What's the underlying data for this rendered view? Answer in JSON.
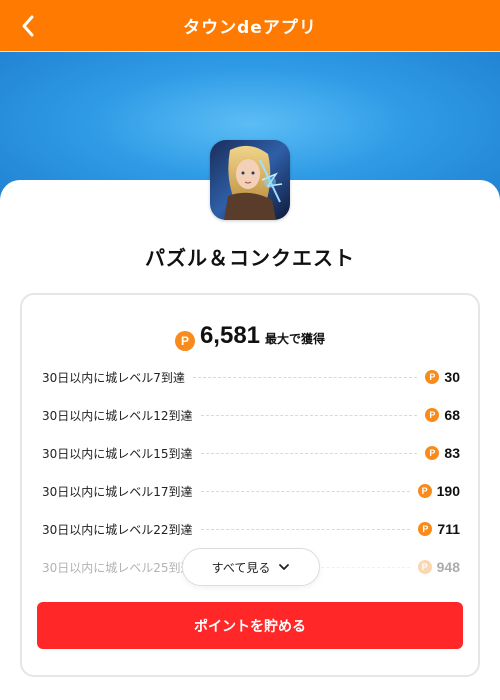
{
  "header": {
    "title": "タウンdeアプリ",
    "back_icon": "chevron-left-icon",
    "background_color": "#ff7a00"
  },
  "app": {
    "name": "パズル＆コンクエスト"
  },
  "reward": {
    "coin_icon": "P",
    "total_value": "6,581",
    "total_suffix": "最大で獲得",
    "coin_color": "#f98b1c",
    "tasks": [
      {
        "label": "30日以内に城レベル7到達",
        "points": "30"
      },
      {
        "label": "30日以内に城レベル12到達",
        "points": "68"
      },
      {
        "label": "30日以内に城レベル15到達",
        "points": "83"
      },
      {
        "label": "30日以内に城レベル17到達",
        "points": "190"
      },
      {
        "label": "30日以内に城レベル22到達",
        "points": "711"
      },
      {
        "label": "30日以内に城レベル25到達",
        "points": "948"
      }
    ],
    "see_all_label": "すべて見る",
    "cta_label": "ポイントを貯める",
    "cta_color": "#ff2727"
  }
}
